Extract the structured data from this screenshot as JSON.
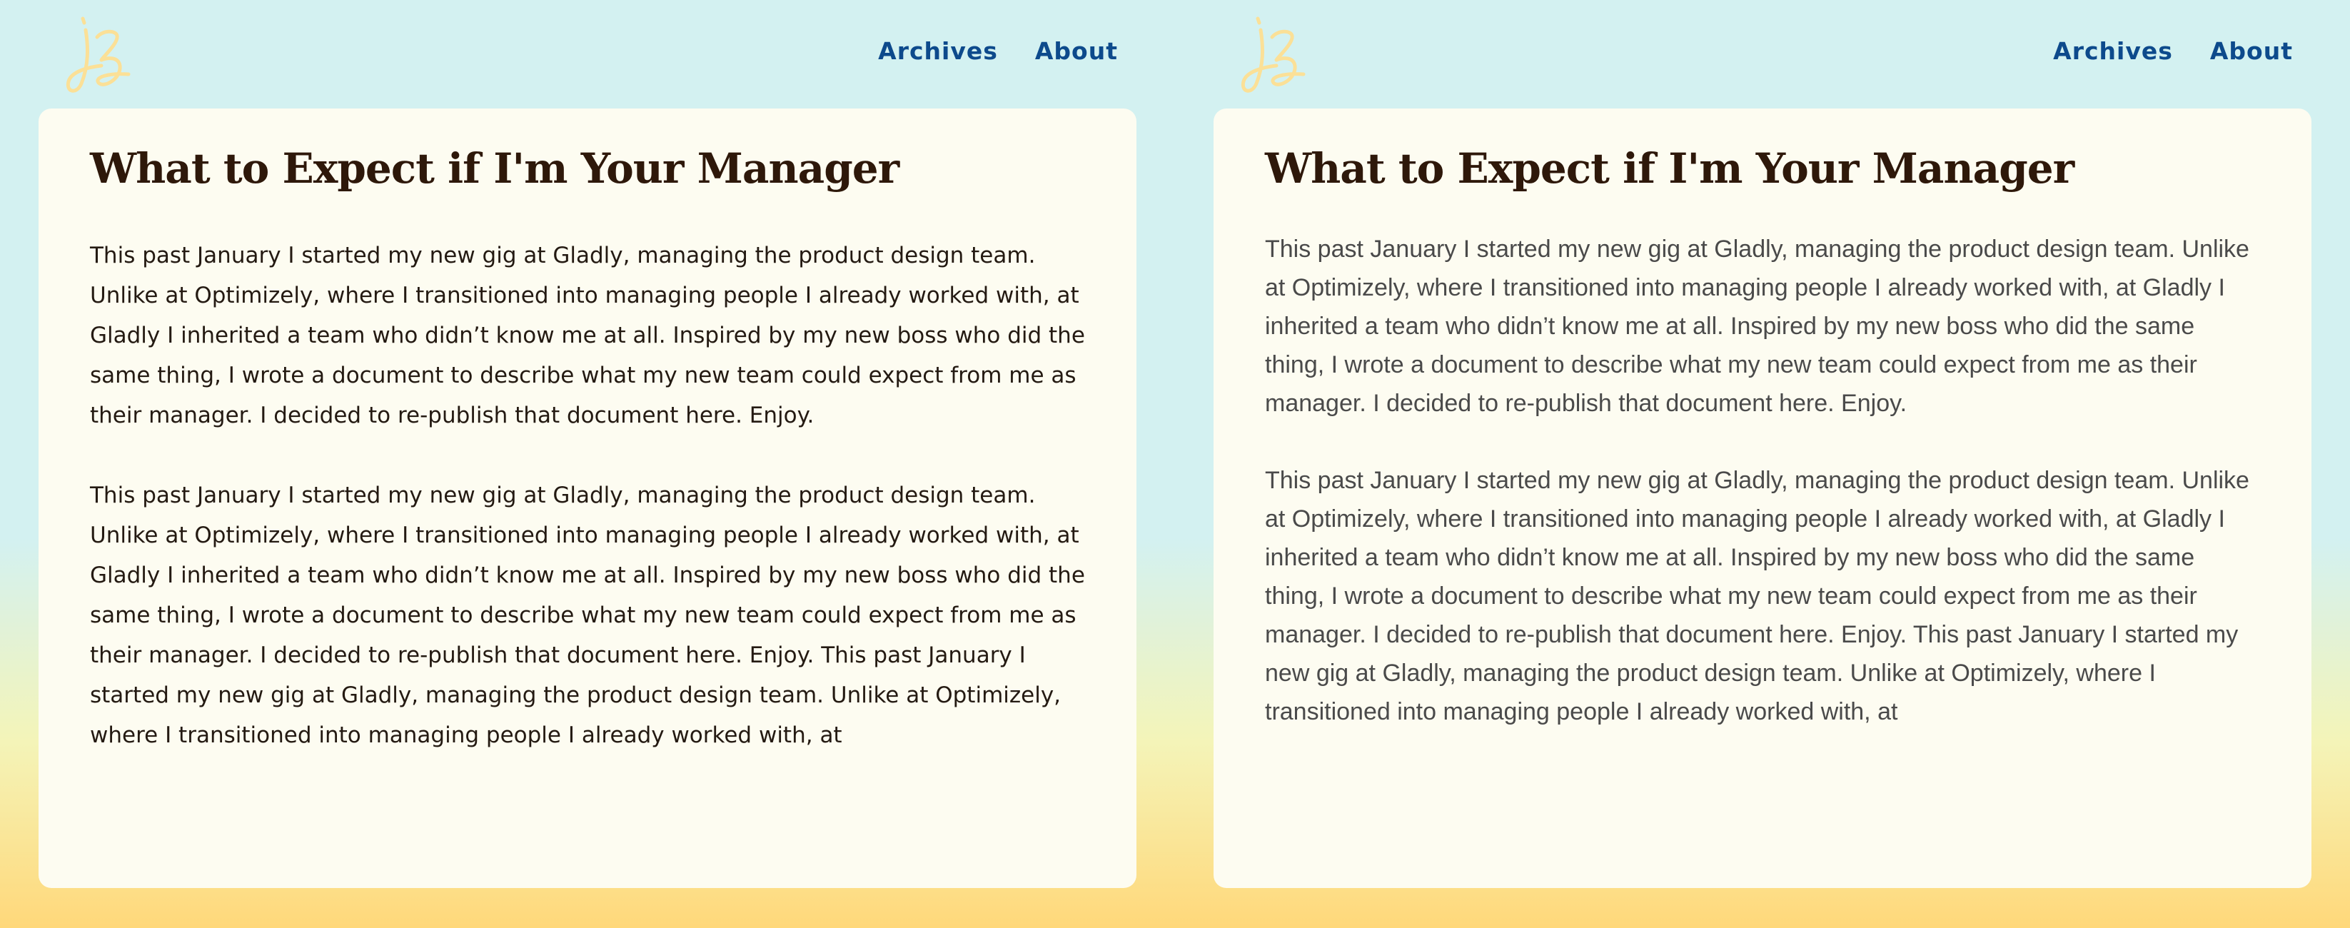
{
  "nav": {
    "archives_label": "Archives",
    "about_label": "About"
  },
  "logo": {
    "text": "jz",
    "color": "#fbe097"
  },
  "post": {
    "title": "What to Expect if I'm Your Manager",
    "paragraph_1": "This past January I started my new gig at Gladly, managing the product design team. Unlike at Optimizely, where I transitioned into managing people I already worked with, at Gladly I inherited a team who didn’t know me at all. Inspired by my new boss who did the same thing, I wrote a document to describe what my new team could expect from me as their manager. I decided to re-publish that document here. Enjoy.",
    "paragraph_2": "This past January I started my new gig at Gladly, managing the product design team. Unlike at Optimizely, where I transitioned into managing people I already worked with, at Gladly I inherited a team who didn’t know me at all. Inspired by my new boss who did the same thing, I wrote a document to describe what my new team could expect from me as their manager. I decided to re-publish that document here. Enjoy. This past January I started my new gig at Gladly, managing the product design team. Unlike at Optimizely, where I transitioned into managing people I already worked with, at"
  },
  "colors": {
    "nav_link": "#0d4a8c",
    "title": "#2e180a",
    "card_background": "#fdfcf1",
    "bg_top": "#d3f1f1",
    "bg_bottom": "#ffd87a"
  }
}
